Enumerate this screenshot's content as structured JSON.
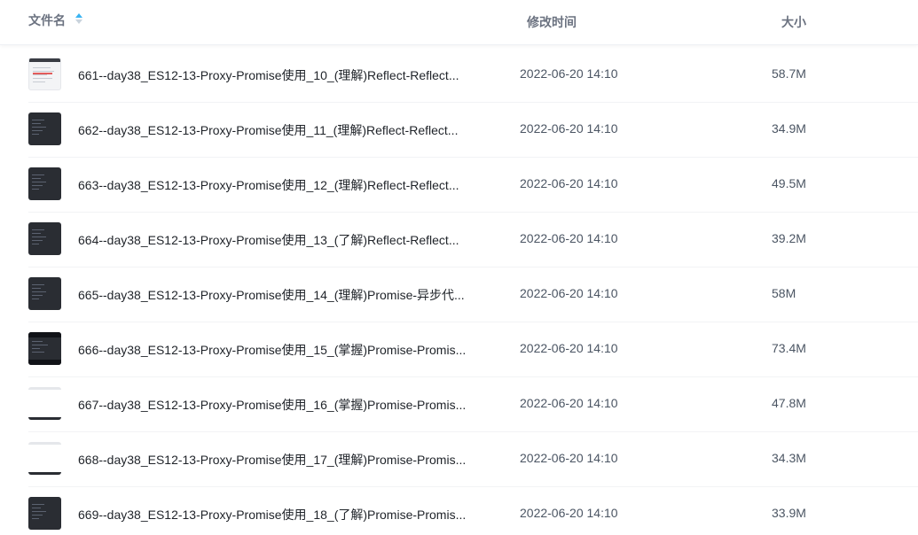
{
  "header": {
    "name_label": "文件名",
    "time_label": "修改时间",
    "size_label": "大小",
    "sort_icon": "sort-ascending-icon"
  },
  "colors": {
    "accent": "#3bb4f2",
    "text_primary": "#1f2329",
    "text_secondary": "#4b5563",
    "header_text": "#6b7280"
  },
  "files": [
    {
      "name": "661--day38_ES12-13-Proxy-Promise使用_10_(理解)Reflect-Reflect...",
      "time": "2022-06-20 14:10",
      "size": "58.7M",
      "thumb": "light-red"
    },
    {
      "name": "662--day38_ES12-13-Proxy-Promise使用_11_(理解)Reflect-Reflect...",
      "time": "2022-06-20 14:10",
      "size": "34.9M",
      "thumb": "dark"
    },
    {
      "name": "663--day38_ES12-13-Proxy-Promise使用_12_(理解)Reflect-Reflect...",
      "time": "2022-06-20 14:10",
      "size": "49.5M",
      "thumb": "dark"
    },
    {
      "name": "664--day38_ES12-13-Proxy-Promise使用_13_(了解)Reflect-Reflect...",
      "time": "2022-06-20 14:10",
      "size": "39.2M",
      "thumb": "dark"
    },
    {
      "name": "665--day38_ES12-13-Proxy-Promise使用_14_(理解)Promise-异步代...",
      "time": "2022-06-20 14:10",
      "size": "58M",
      "thumb": "dark"
    },
    {
      "name": "666--day38_ES12-13-Proxy-Promise使用_15_(掌握)Promise-Promis...",
      "time": "2022-06-20 14:10",
      "size": "73.4M",
      "thumb": "dark-framed"
    },
    {
      "name": "667--day38_ES12-13-Proxy-Promise使用_16_(掌握)Promise-Promis...",
      "time": "2022-06-20 14:10",
      "size": "47.8M",
      "thumb": "white"
    },
    {
      "name": "668--day38_ES12-13-Proxy-Promise使用_17_(理解)Promise-Promis...",
      "time": "2022-06-20 14:10",
      "size": "34.3M",
      "thumb": "white"
    },
    {
      "name": "669--day38_ES12-13-Proxy-Promise使用_18_(了解)Promise-Promis...",
      "time": "2022-06-20 14:10",
      "size": "33.9M",
      "thumb": "dark"
    }
  ]
}
